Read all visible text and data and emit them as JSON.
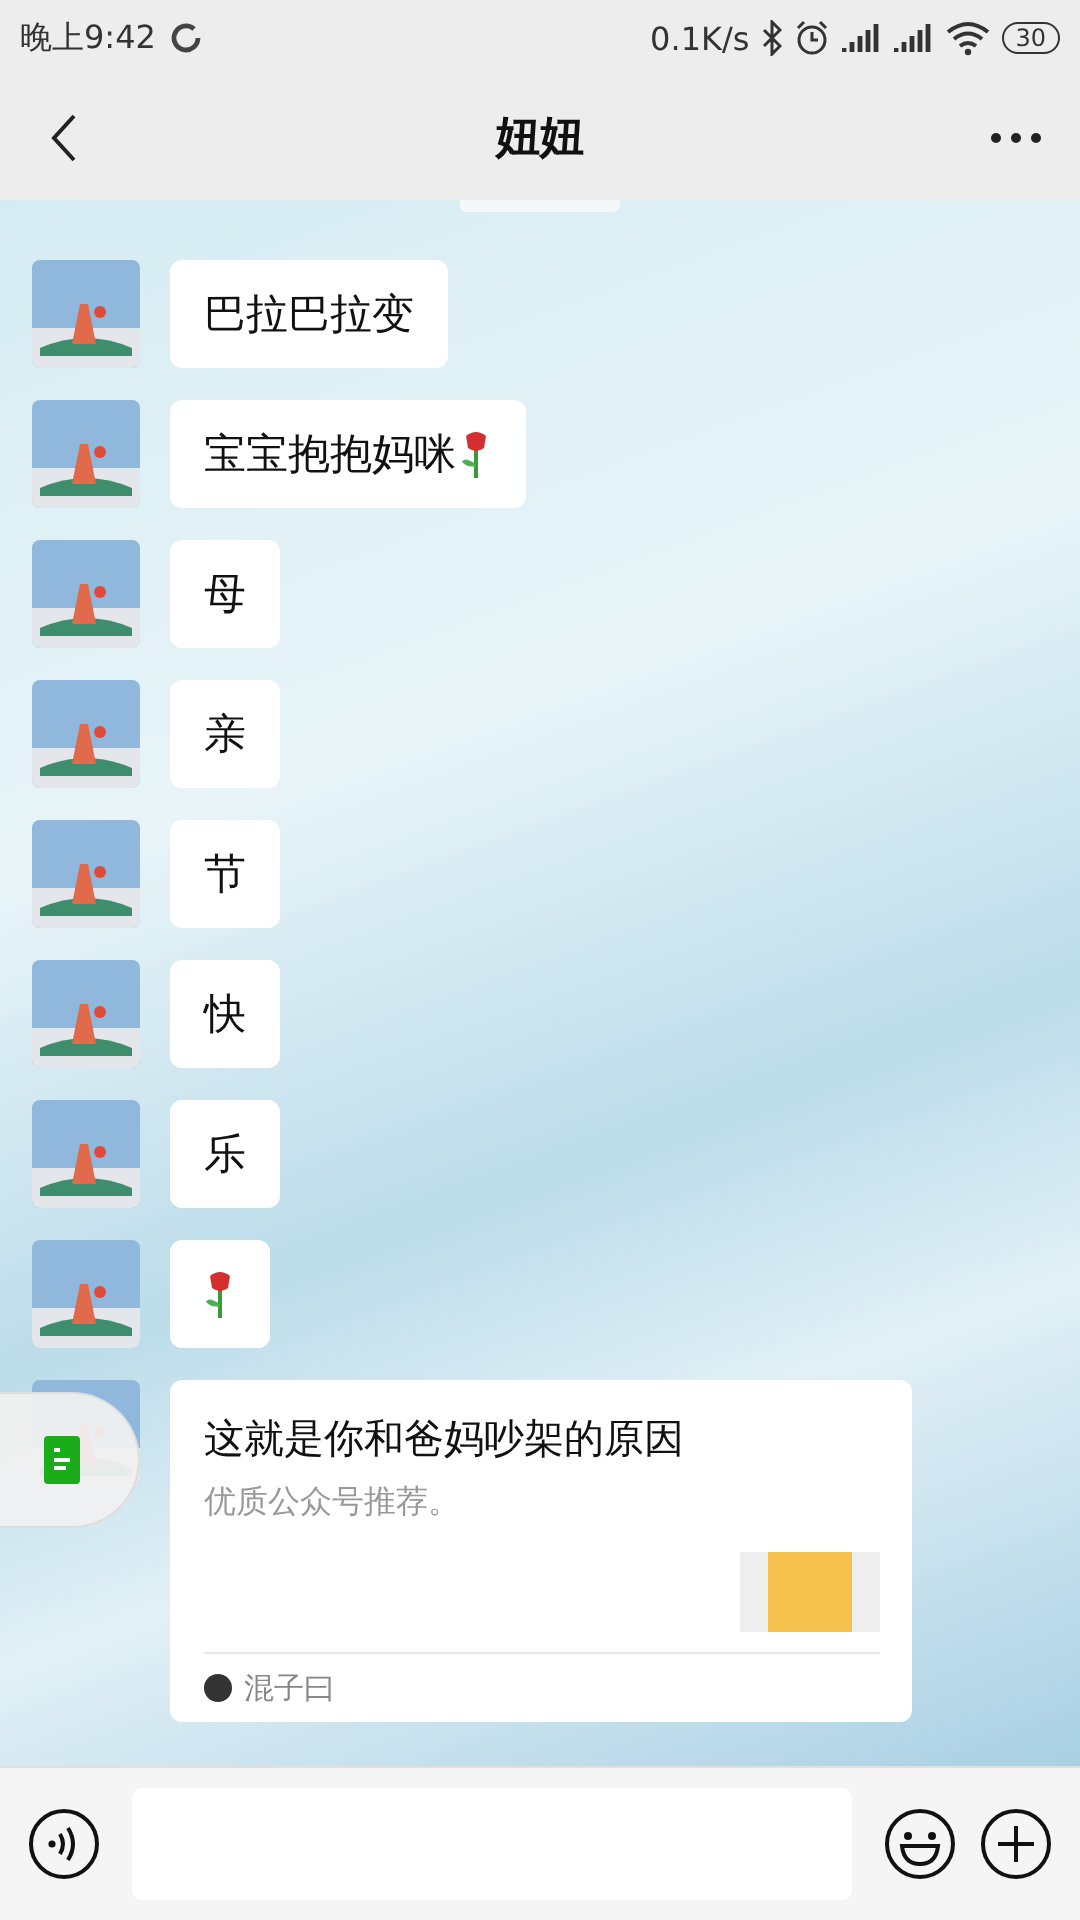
{
  "status_bar": {
    "time": "晚上9:42",
    "speed": "0.1K/s",
    "battery": "30"
  },
  "header": {
    "title": "妞妞"
  },
  "messages": [
    {
      "text": "巴拉巴拉变",
      "rose": false
    },
    {
      "text": "宝宝抱抱妈咪",
      "rose": true
    },
    {
      "text": "母",
      "rose": false
    },
    {
      "text": "亲",
      "rose": false
    },
    {
      "text": "节",
      "rose": false
    },
    {
      "text": "快",
      "rose": false
    },
    {
      "text": "乐",
      "rose": false
    },
    {
      "rose": true
    }
  ],
  "article": {
    "title": "这就是你和爸妈吵架的原因",
    "description": "优质公众号推荐。",
    "source": "混子曰"
  }
}
